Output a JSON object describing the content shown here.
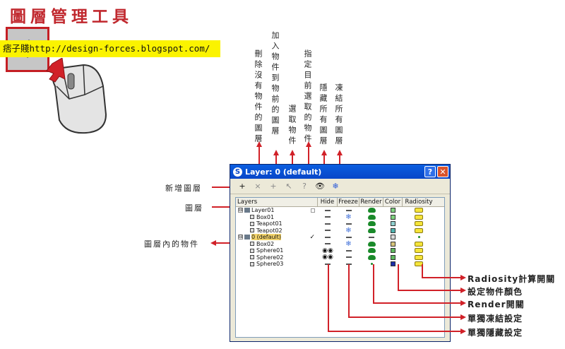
{
  "page": {
    "title": "圖層管理工具",
    "banner": "痞子賤http://design-forces.blogspot.com/"
  },
  "annotations_top": [
    "刪除沒有物件的圖層",
    "加入物件到物前的圖層",
    "選取物件",
    "指定目前選取的物件",
    "隱藏所有圖層",
    "凍結所有圖層"
  ],
  "annotations_left": [
    "新增圖層",
    "圖層",
    "圖層內的物件"
  ],
  "annotations_right": [
    "Radiosity計算開關",
    "設定物件顏色",
    "Render開關",
    "單獨凍結設定",
    "單獨隱藏設定"
  ],
  "dialog": {
    "title": "Layer: 0 (default)",
    "help_label": "?",
    "close_label": "✕",
    "tools": [
      "+",
      "×",
      "+",
      "↖",
      "?",
      "👁",
      "❄"
    ],
    "columns": [
      "Layers",
      "Hide",
      "Freeze",
      "Render",
      "Color",
      "Radiosity"
    ],
    "rows": [
      {
        "name": "Layer01",
        "kind": "layer",
        "expander": "⊟",
        "mark": "box",
        "hide": "dash",
        "freeze": "dash",
        "render": "teapot",
        "color": "#7fd27f",
        "radiosity": "on"
      },
      {
        "name": "Box01",
        "kind": "object",
        "hide": "dash",
        "freeze": "snow",
        "render": "teapot",
        "color": "#7fd27f",
        "radiosity": "on"
      },
      {
        "name": "Teapot01",
        "kind": "object",
        "hide": "dash",
        "freeze": "dash",
        "render": "teapot",
        "color": "#8fd0cf",
        "radiosity": "on"
      },
      {
        "name": "Teapot02",
        "kind": "object",
        "hide": "dash",
        "freeze": "snow",
        "render": "teapot",
        "color": "#4fb3b0",
        "radiosity": "on"
      },
      {
        "name": "0 (default)",
        "kind": "layer",
        "expander": "⊟",
        "mark": "tick",
        "selected": true,
        "hide": "dash",
        "freeze": "dash",
        "render": "dash",
        "color": "#d9d9d9",
        "radiosity": "dot"
      },
      {
        "name": "Box02",
        "kind": "object",
        "hide": "dash",
        "freeze": "snow",
        "render": "teapot",
        "color": "#d6c37a",
        "radiosity": "on"
      },
      {
        "name": "Sphere01",
        "kind": "object",
        "hide": "eye",
        "freeze": "dash",
        "render": "teapot",
        "color": "#5fb85f",
        "radiosity": "on"
      },
      {
        "name": "Sphere02",
        "kind": "object",
        "hide": "eye",
        "freeze": "dash",
        "render": "teapot",
        "color": "#5fb85f",
        "radiosity": "on"
      },
      {
        "name": "Sphere03",
        "kind": "object",
        "hide": "dash",
        "freeze": "dash",
        "render": "dot",
        "color": "#1c2ea8",
        "radiosity": "on"
      }
    ],
    "tick_label": "✓"
  }
}
